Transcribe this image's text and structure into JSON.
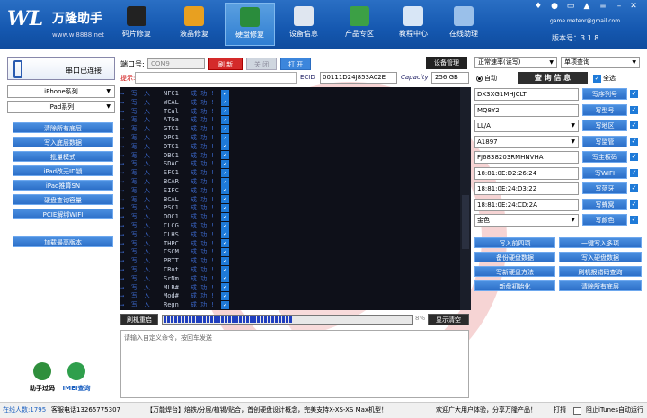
{
  "app": {
    "logo_mark": "WL",
    "logo_name": "万隆助手",
    "logo_url": "www.wl8888.net",
    "account": "game.meteor@gmail.com",
    "version": "版本号：3.1.8"
  },
  "nav": [
    {
      "label": "码片修复",
      "icon": "chip-icon",
      "color": "#222"
    },
    {
      "label": "液晶修复",
      "icon": "lcd-icon",
      "color": "#e8a020"
    },
    {
      "label": "硬盘修复",
      "icon": "disk-icon",
      "color": "#2a8c3c",
      "active": true
    },
    {
      "label": "设备信息",
      "icon": "device-icon",
      "color": "#dfe6f0"
    },
    {
      "label": "产品专区",
      "icon": "cart-icon",
      "color": "#3ca045"
    },
    {
      "label": "教程中心",
      "icon": "book-icon",
      "color": "#d8e6f6"
    },
    {
      "label": "在线助理",
      "icon": "gem-icon",
      "color": "#9ac0ea"
    }
  ],
  "left": {
    "conn_status": "串口已连接",
    "series": "iPhone系列",
    "model": "iPad系列",
    "buttons": [
      "清除所有底层",
      "写入底层数据",
      "批量模式",
      "iPad改无ID锁",
      "iPad推算SN",
      "硬盘查询容量",
      "PCIE解绑WIFI"
    ],
    "load_btn": "加载最高版本",
    "assist": "助手过码",
    "imei": "IMEI查询"
  },
  "com": {
    "label": "端口号:",
    "port": "COM9",
    "refresh": "刷 新",
    "close": "关 闭",
    "open": "打 开",
    "device_mgr": "设备管理"
  },
  "hint": {
    "label": "提示:",
    "ecid_label": "ECID",
    "ecid": "00111D24J853A02E",
    "cap_label": "Capacity",
    "capacity": "256 GB"
  },
  "log": {
    "arrow": "→",
    "write": "写",
    "into": "入",
    "status": "成 功 !",
    "items": [
      "NFC1",
      "WCAL",
      "TCal",
      "ATGa",
      "GTC1",
      "DPC1",
      "DTC1",
      "DBC1",
      "SDAC",
      "SFC1",
      "BCAR",
      "SIFC",
      "BCAL",
      "PSC1",
      "OOC1",
      "CLCG",
      "CLHS",
      "THPC",
      "CSCM",
      "PRTT",
      "CRot",
      "SrNm",
      "MLB#",
      "Mod#",
      "Regn"
    ]
  },
  "progress": {
    "flash": "刷机重启",
    "value": 0.52,
    "text": "8%",
    "clear": "显示清空"
  },
  "cmd": {
    "placeholder": "请输入自定义命令，按回车发送"
  },
  "right": {
    "speed": "正常速率(读写)",
    "mode": "单项查询",
    "auto": "自动",
    "query": "查 询 信 息",
    "all": "全选",
    "fields": [
      {
        "value": "DX3XG1MHJCLT",
        "btn": "写序列号",
        "sel": false
      },
      {
        "value": "MQ8Y2",
        "btn": "写型号",
        "sel": false
      },
      {
        "value": "LL/A",
        "btn": "写地区",
        "sel": true
      },
      {
        "value": "A1897",
        "btn": "写监管",
        "sel": true
      },
      {
        "value": "FJ6838203RMHNVHA",
        "btn": "写主板码",
        "sel": false
      },
      {
        "value": "18:81:0E:D2:26:24",
        "btn": "写WIFI",
        "sel": false
      },
      {
        "value": "18:81:0E:24:D3:22",
        "btn": "写蓝牙",
        "sel": false
      },
      {
        "value": "18:81:0E:24:CD:2A",
        "btn": "写蜂窝",
        "sel": false
      },
      {
        "value": "金色",
        "btn": "写颜色",
        "sel": true
      }
    ],
    "actions": [
      "写入前四项",
      "一键写入多项",
      "备份硬盘数据",
      "写入硬盘数据",
      "写新硬盘方法",
      "刷机报错码查询",
      "新盘初始化",
      "清除所有底层"
    ]
  },
  "status": {
    "online": "在线人数:1795",
    "phone": "客服电话13265775307",
    "notice": "【万能焊台】焙铁/分层/植锡/贴合，首创硬盘设计概念，完美支持X-XS-XS Max机型！",
    "welcome": "欢迎广大用户体验，分享万隆产品！",
    "print": "打揹",
    "itunes": "阻止iTunes自动运行"
  },
  "colors": {
    "accent": "#2c6fc8",
    "brand_red": "#d42a2a",
    "console": "#0e1019",
    "log_blue": "#3a66c8"
  }
}
